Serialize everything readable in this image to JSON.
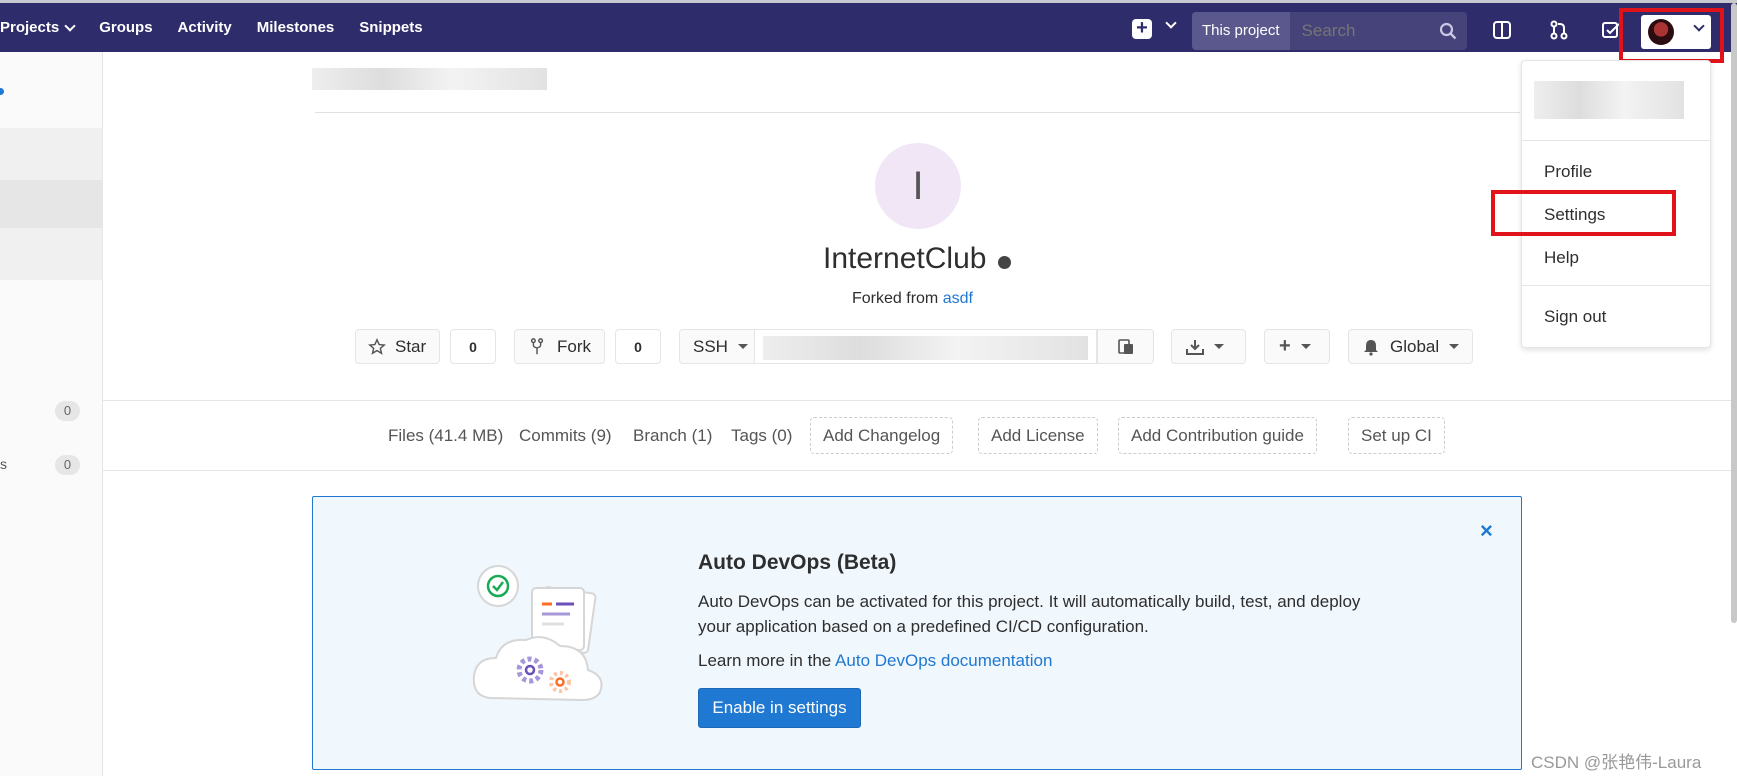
{
  "nav": {
    "items": [
      "Projects",
      "Groups",
      "Activity",
      "Milestones",
      "Snippets"
    ],
    "search_scope": "This project",
    "search_placeholder": "Search"
  },
  "sidebar": {
    "badges": [
      "0",
      "0"
    ],
    "partial_label": "s"
  },
  "project": {
    "avatar_letter": "I",
    "name": "InternetClub",
    "forked_prefix": "Forked from",
    "forked_link": "asdf",
    "star_label": "Star",
    "star_count": "0",
    "fork_label": "Fork",
    "fork_count": "0",
    "clone_protocol": "SSH",
    "notification_label": "Global"
  },
  "stats": {
    "files": "Files (41.4 MB)",
    "commits": "Commits (9)",
    "branch": "Branch (1)",
    "tags": "Tags (0)",
    "add_changelog": "Add Changelog",
    "add_license": "Add License",
    "add_contribution": "Add Contribution guide",
    "setup_ci": "Set up CI"
  },
  "devops": {
    "title": "Auto DevOps (Beta)",
    "description": "Auto DevOps can be activated for this project. It will automatically build, test, and deploy your application based on a predefined CI/CD configuration.",
    "learn_prefix": "Learn more in the",
    "learn_link": "Auto DevOps documentation",
    "enable_button": "Enable in settings",
    "close_glyph": "×"
  },
  "user_menu": {
    "profile": "Profile",
    "settings": "Settings",
    "help": "Help",
    "sign_out": "Sign out"
  },
  "watermark": "CSDN @张艳伟-Laura",
  "colors": {
    "navbar": "#2f2c6b",
    "link": "#1f78d1",
    "highlight_box": "#e0131a"
  }
}
